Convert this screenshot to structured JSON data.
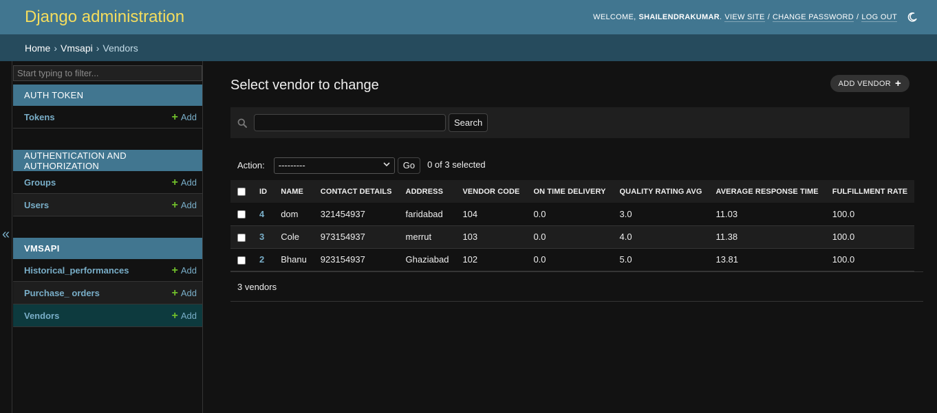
{
  "header": {
    "branding": "Django administration",
    "welcome": "WELCOME,",
    "username": "SHAILENDRAKUMAR",
    "period": ".",
    "view_site": "VIEW SITE",
    "change_password": "CHANGE PASSWORD",
    "log_out": "LOG OUT",
    "sep": "/",
    "theme_icon": "moon-icon"
  },
  "breadcrumbs": {
    "home": "Home",
    "app": "Vmsapi",
    "current": "Vendors",
    "sep": "›"
  },
  "sidebar": {
    "toggle_glyph": "«",
    "filter_placeholder": "Start typing to filter...",
    "add_label": "Add",
    "modules": [
      {
        "caption": "AUTH TOKEN",
        "models": [
          "Tokens"
        ]
      },
      {
        "caption": "AUTHENTICATION AND AUTHORIZATION",
        "models": [
          "Groups",
          "Users"
        ]
      },
      {
        "caption": "VMSAPI",
        "models": [
          "Historical_performances",
          "Purchase_ orders",
          "Vendors"
        ]
      }
    ]
  },
  "content": {
    "title": "Select vendor to change",
    "add_button": "ADD VENDOR",
    "search_button": "Search",
    "search_value": "",
    "action_label": "Action:",
    "action_selected": "---------",
    "go_button": "Go",
    "selection_counter": "0 of 3 selected",
    "columns": [
      "ID",
      "NAME",
      "CONTACT DETAILS",
      "ADDRESS",
      "VENDOR CODE",
      "ON TIME DELIVERY",
      "QUALITY RATING AVG",
      "AVERAGE RESPONSE TIME",
      "FULFILLMENT RATE"
    ],
    "rows": [
      [
        "4",
        "dom",
        "321454937",
        "faridabad",
        "104",
        "0.0",
        "3.0",
        "11.03",
        "100.0"
      ],
      [
        "3",
        "Cole",
        "973154937",
        "merrut",
        "103",
        "0.0",
        "4.0",
        "11.38",
        "100.0"
      ],
      [
        "2",
        "Bhanu",
        "923154937",
        "Ghaziabad",
        "102",
        "0.0",
        "5.0",
        "13.81",
        "100.0"
      ]
    ],
    "paginator": "3 vendors"
  },
  "colors": {
    "header_bg": "#417690",
    "breadcrumb_bg": "#264b5d",
    "branding": "#f5dd5d",
    "link": "#79aec8",
    "add_green": "#70bf2b",
    "current_row": "#0d3a3e"
  }
}
